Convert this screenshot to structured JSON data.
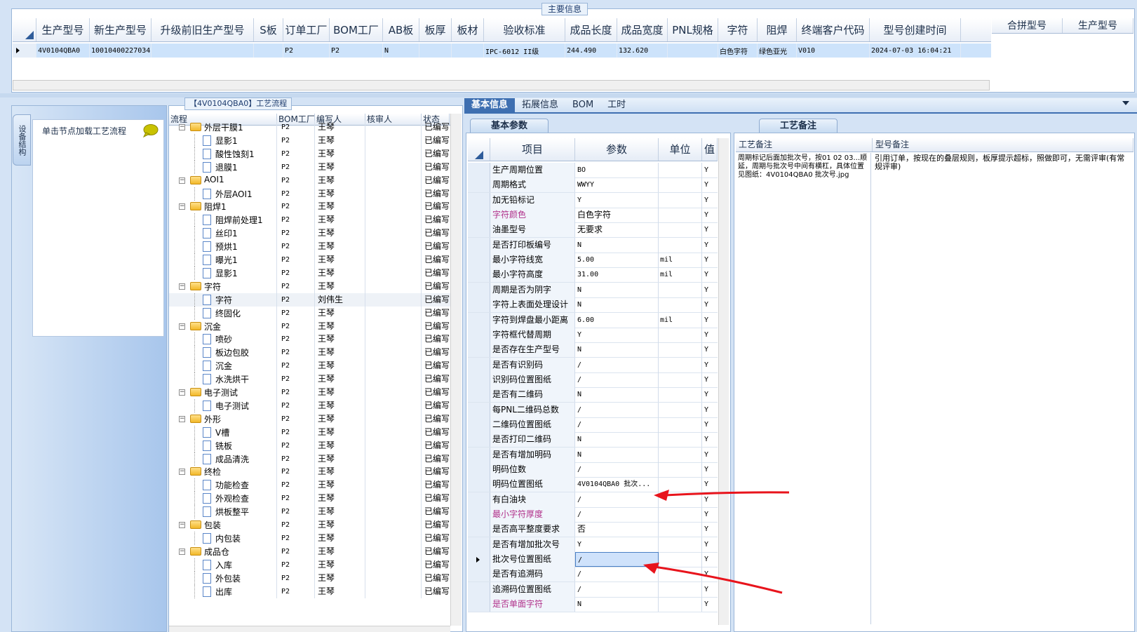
{
  "top": {
    "group_title": "主要信息",
    "headers": [
      "生产型号",
      "新生产型号",
      "升级前旧生产型号",
      "S板",
      "订单工厂",
      "BOM工厂",
      "AB板",
      "板厚",
      "板材",
      "验收标准",
      "成品长度",
      "成品宽度",
      "PNL规格",
      "字符",
      "阻焊",
      "终端客户代码",
      "型号创建时间"
    ],
    "row": [
      "4V0104QBA0",
      "10010400227034",
      "",
      "",
      "P2",
      "P2",
      "N",
      "",
      "",
      "IPC-6012 II级",
      "244.490",
      "132.620",
      "",
      "白色字符",
      "绿色亚光",
      "V010",
      "2024-07-03 16:04:21"
    ],
    "merge_headers": [
      "合拼型号",
      "生产型号"
    ]
  },
  "left": {
    "vertical_tab": "设备结构",
    "load_hint": "单击节点加载工艺流程"
  },
  "tree": {
    "title": "【4V0104QBA0】工艺流程",
    "headers": [
      "流程",
      "BOM工厂",
      "编写人",
      "核审人",
      "状态"
    ],
    "rows": [
      {
        "name": "外层干膜1",
        "level": 1,
        "type": "folder",
        "bom": "P2",
        "writer": "王琴",
        "status": "已编写"
      },
      {
        "name": "显影1",
        "level": 2,
        "type": "doc",
        "bom": "P2",
        "writer": "王琴",
        "status": "已编写"
      },
      {
        "name": "酸性蚀刻1",
        "level": 2,
        "type": "doc",
        "bom": "P2",
        "writer": "王琴",
        "status": "已编写"
      },
      {
        "name": "退膜1",
        "level": 2,
        "type": "doc",
        "bom": "P2",
        "writer": "王琴",
        "status": "已编写"
      },
      {
        "name": "AOI1",
        "level": 1,
        "type": "folder",
        "bom": "P2",
        "writer": "王琴",
        "status": "已编写"
      },
      {
        "name": "外层AOI1",
        "level": 2,
        "type": "doc",
        "bom": "P2",
        "writer": "王琴",
        "status": "已编写"
      },
      {
        "name": "阻焊1",
        "level": 1,
        "type": "folder",
        "bom": "P2",
        "writer": "王琴",
        "status": "已编写"
      },
      {
        "name": "阻焊前处理1",
        "level": 2,
        "type": "doc",
        "bom": "P2",
        "writer": "王琴",
        "status": "已编写"
      },
      {
        "name": "丝印1",
        "level": 2,
        "type": "doc",
        "bom": "P2",
        "writer": "王琴",
        "status": "已编写"
      },
      {
        "name": "预烘1",
        "level": 2,
        "type": "doc",
        "bom": "P2",
        "writer": "王琴",
        "status": "已编写"
      },
      {
        "name": "曝光1",
        "level": 2,
        "type": "doc",
        "bom": "P2",
        "writer": "王琴",
        "status": "已编写"
      },
      {
        "name": "显影1",
        "level": 2,
        "type": "doc",
        "bom": "P2",
        "writer": "王琴",
        "status": "已编写"
      },
      {
        "name": "字符",
        "level": 1,
        "type": "folder",
        "bom": "P2",
        "writer": "王琴",
        "status": "已编写"
      },
      {
        "name": "字符",
        "level": 2,
        "type": "doc",
        "bom": "P2",
        "writer": "刘伟生",
        "status": "已编写"
      },
      {
        "name": "终固化",
        "level": 2,
        "type": "doc",
        "bom": "P2",
        "writer": "王琴",
        "status": "已编写"
      },
      {
        "name": "沉金",
        "level": 1,
        "type": "folder",
        "bom": "P2",
        "writer": "王琴",
        "status": "已编写"
      },
      {
        "name": "喷砂",
        "level": 2,
        "type": "doc",
        "bom": "P2",
        "writer": "王琴",
        "status": "已编写"
      },
      {
        "name": "板边包胶",
        "level": 2,
        "type": "doc",
        "bom": "P2",
        "writer": "王琴",
        "status": "已编写"
      },
      {
        "name": "沉金",
        "level": 2,
        "type": "doc",
        "bom": "P2",
        "writer": "王琴",
        "status": "已编写"
      },
      {
        "name": "水洗烘干",
        "level": 2,
        "type": "doc",
        "bom": "P2",
        "writer": "王琴",
        "status": "已编写"
      },
      {
        "name": "电子测试",
        "level": 1,
        "type": "folder",
        "bom": "P2",
        "writer": "王琴",
        "status": "已编写"
      },
      {
        "name": "电子测试",
        "level": 2,
        "type": "doc",
        "bom": "P2",
        "writer": "王琴",
        "status": "已编写"
      },
      {
        "name": "外形",
        "level": 1,
        "type": "folder",
        "bom": "P2",
        "writer": "王琴",
        "status": "已编写"
      },
      {
        "name": "V槽",
        "level": 2,
        "type": "doc",
        "bom": "P2",
        "writer": "王琴",
        "status": "已编写"
      },
      {
        "name": "铣板",
        "level": 2,
        "type": "doc",
        "bom": "P2",
        "writer": "王琴",
        "status": "已编写"
      },
      {
        "name": "成品清洗",
        "level": 2,
        "type": "doc",
        "bom": "P2",
        "writer": "王琴",
        "status": "已编写"
      },
      {
        "name": "终检",
        "level": 1,
        "type": "folder",
        "bom": "P2",
        "writer": "王琴",
        "status": "已编写"
      },
      {
        "name": "功能检查",
        "level": 2,
        "type": "doc",
        "bom": "P2",
        "writer": "王琴",
        "status": "已编写"
      },
      {
        "name": "外观检查",
        "level": 2,
        "type": "doc",
        "bom": "P2",
        "writer": "王琴",
        "status": "已编写"
      },
      {
        "name": "烘板整平",
        "level": 2,
        "type": "doc",
        "bom": "P2",
        "writer": "王琴",
        "status": "已编写"
      },
      {
        "name": "包装",
        "level": 1,
        "type": "folder",
        "bom": "P2",
        "writer": "王琴",
        "status": "已编写"
      },
      {
        "name": "内包装",
        "level": 2,
        "type": "doc",
        "bom": "P2",
        "writer": "王琴",
        "status": "已编写"
      },
      {
        "name": "成品仓",
        "level": 1,
        "type": "folder",
        "bom": "P2",
        "writer": "王琴",
        "status": "已编写"
      },
      {
        "name": "入库",
        "level": 2,
        "type": "doc",
        "bom": "P2",
        "writer": "王琴",
        "status": "已编写"
      },
      {
        "name": "外包装",
        "level": 2,
        "type": "doc",
        "bom": "P2",
        "writer": "王琴",
        "status": "已编写"
      },
      {
        "name": "出库",
        "level": 2,
        "type": "doc",
        "bom": "P2",
        "writer": "王琴",
        "status": "已编写"
      }
    ]
  },
  "tabs": [
    "基本信息",
    "拓展信息",
    "BOM",
    "工时"
  ],
  "params": {
    "subtab": "基本参数",
    "headers": [
      "项目",
      "参数",
      "单位",
      "值"
    ],
    "rows": [
      {
        "item": "生产周期位置",
        "param": "BO",
        "unit": "",
        "flag": "Y"
      },
      {
        "item": "周期格式",
        "param": "WWYY",
        "unit": "",
        "flag": "Y"
      },
      {
        "item": "加无铅标记",
        "param": "Y",
        "unit": "",
        "flag": "Y"
      },
      {
        "item": "字符颜色",
        "param": "白色字符",
        "unit": "",
        "flag": "Y",
        "pink": true
      },
      {
        "item": "油墨型号",
        "param": "无要求",
        "unit": "",
        "flag": "Y"
      },
      {
        "item": "是否打印板编号",
        "param": "N",
        "unit": "",
        "flag": "Y"
      },
      {
        "item": "最小字符线宽",
        "param": "5.00",
        "unit": "mil",
        "flag": "Y"
      },
      {
        "item": "最小字符高度",
        "param": "31.00",
        "unit": "mil",
        "flag": "Y"
      },
      {
        "item": "周期是否为阴字",
        "param": "N",
        "unit": "",
        "flag": "Y"
      },
      {
        "item": "字符上表面处理设计",
        "param": "N",
        "unit": "",
        "flag": "Y"
      },
      {
        "item": "字符到焊盘最小距离",
        "param": "6.00",
        "unit": "mil",
        "flag": "Y"
      },
      {
        "item": "字符框代替周期",
        "param": "Y",
        "unit": "",
        "flag": "Y"
      },
      {
        "item": "是否存在生产型号",
        "param": "N",
        "unit": "",
        "flag": "Y"
      },
      {
        "item": "是否有识别码",
        "param": "/",
        "unit": "",
        "flag": "Y"
      },
      {
        "item": "识别码位置图纸",
        "param": "/",
        "unit": "",
        "flag": "Y"
      },
      {
        "item": "是否有二维码",
        "param": "N",
        "unit": "",
        "flag": "Y"
      },
      {
        "item": "每PNL二维码总数",
        "param": "/",
        "unit": "",
        "flag": "Y"
      },
      {
        "item": "二维码位置图纸",
        "param": "/",
        "unit": "",
        "flag": "Y"
      },
      {
        "item": "是否打印二维码",
        "param": "N",
        "unit": "",
        "flag": "Y"
      },
      {
        "item": "是否有增加明码",
        "param": "N",
        "unit": "",
        "flag": "Y"
      },
      {
        "item": "明码位数",
        "param": "/",
        "unit": "",
        "flag": "Y"
      },
      {
        "item": "明码位置图纸",
        "param": "4V0104QBA0 批次...",
        "unit": "",
        "flag": "Y"
      },
      {
        "item": "有白油块",
        "param": "/",
        "unit": "",
        "flag": "Y"
      },
      {
        "item": "最小字符厚度",
        "param": "/",
        "unit": "",
        "flag": "Y",
        "pink": true
      },
      {
        "item": "是否高平整度要求",
        "param": "否",
        "unit": "",
        "flag": "Y"
      },
      {
        "item": "是否有增加批次号",
        "param": "Y",
        "unit": "",
        "flag": "Y"
      },
      {
        "item": "批次号位置图纸",
        "param": "/",
        "unit": "",
        "flag": "Y",
        "current": true
      },
      {
        "item": "是否有追溯码",
        "param": "/",
        "unit": "",
        "flag": "Y"
      },
      {
        "item": "追溯码位置图纸",
        "param": "/",
        "unit": "",
        "flag": "Y"
      },
      {
        "item": "是否单面字符",
        "param": "N",
        "unit": "",
        "flag": "Y",
        "pink": true
      }
    ]
  },
  "remark": {
    "subtab": "工艺备注",
    "headers": [
      "工艺备注",
      "型号备注"
    ],
    "process_note": "周期标记后面加批次号，按01 02 03...顺延，周期与批次号中间有横杠，具体位置见图纸：4V0104QBA0 批次号.jpg",
    "model_note": "引用订单，按现在的叠层规则，板厚提示超标，照做即可，无需评审(有常规评审)"
  },
  "annotation_color": "#e8141c"
}
